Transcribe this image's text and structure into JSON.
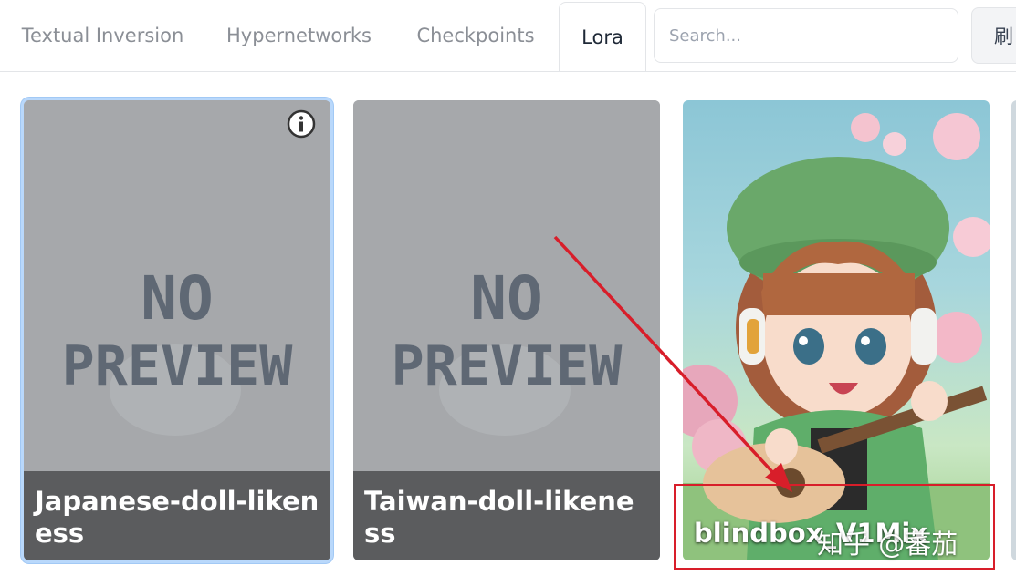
{
  "tabs": [
    {
      "label": "Textual Inversion"
    },
    {
      "label": "Hypernetworks"
    },
    {
      "label": "Checkpoints"
    },
    {
      "label": "Lora",
      "active": true
    }
  ],
  "search": {
    "placeholder": "Search...",
    "value": ""
  },
  "refresh_label": "刷",
  "cards": [
    {
      "label": "Japanese-doll-likeness",
      "preview": "NO PREVIEW",
      "selected": true
    },
    {
      "label": "Taiwan-doll-likeness",
      "preview": "NO PREVIEW"
    },
    {
      "label": "blindbox_V1Mix",
      "preview": "illustration of chibi girl with headphones and guitar"
    }
  ],
  "placeholder_lines": [
    "NO",
    "PREVIEW"
  ],
  "watermark": "知乎 @蕃茄",
  "icons": {
    "info": "info-icon"
  },
  "colors": {
    "highlight": "#d81e2a",
    "selected_border": "#a2c9f5",
    "label_bar": "#5b5c5e"
  }
}
